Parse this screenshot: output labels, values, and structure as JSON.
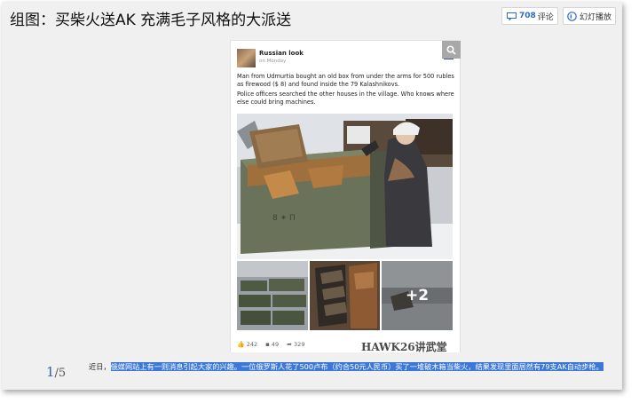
{
  "header": {
    "title": "组图：买柴火送AK 充满毛子风格的大派送",
    "comments_count": "708",
    "comments_label": "评论",
    "slideshow_label": "幻灯播放"
  },
  "post": {
    "page_name": "Russian look",
    "time": "on Monday",
    "paragraph_1": "Man from Udmurtia bought an old box from under the arms for 500 rubles as firewood ($ 8) and found inside the 79 Kalashnikovs.",
    "paragraph_2": "Police officers searched the other houses in the village. Who knows where else could bring machines.",
    "more_photos": "+2",
    "likes": "242",
    "comments": "49",
    "shares": "329",
    "watermark": "HAWK26讲武堂"
  },
  "caption": {
    "current": "1",
    "total": "/5",
    "lead": "近日，",
    "highlighted": "俄媒网站上有一则消息引起大家的兴趣。一位俄罗斯人花了500卢布（约合50元人民币）买了一堆破木箱当柴火，结果发现里面居然有79支AK自动步枪。"
  },
  "colors": {
    "accent": "#2b6cc4",
    "highlight": "#3d78d8",
    "facebook": "#3b5998"
  }
}
